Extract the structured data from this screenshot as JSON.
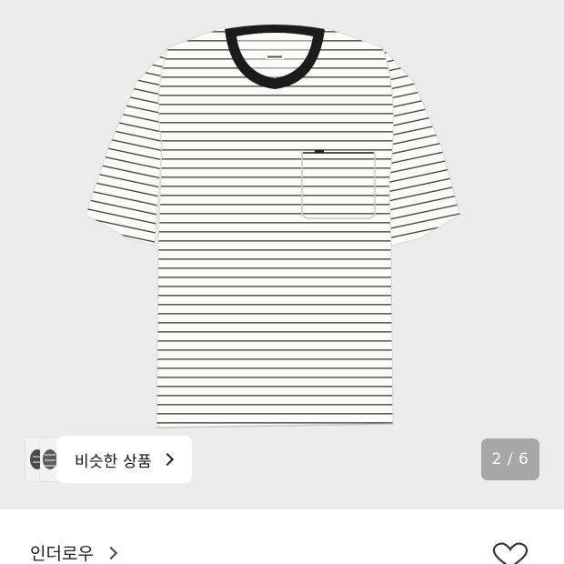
{
  "product": {
    "image_alt": "white striped pocket t-shirt",
    "background_color": "#ececec",
    "shirt_color": "#fbfbfa",
    "stripe_color": "#3b3b3b",
    "collar_color": "#1b1b1b"
  },
  "similar": {
    "label": "비슷한 상품",
    "icon": "chevron-right-icon"
  },
  "pager": {
    "counter": "2 / 6",
    "current": 2,
    "total": 6
  },
  "brand": {
    "name": "인더로우",
    "icon": "chevron-right-icon"
  },
  "wishlist": {
    "icon": "heart-outline-icon"
  }
}
